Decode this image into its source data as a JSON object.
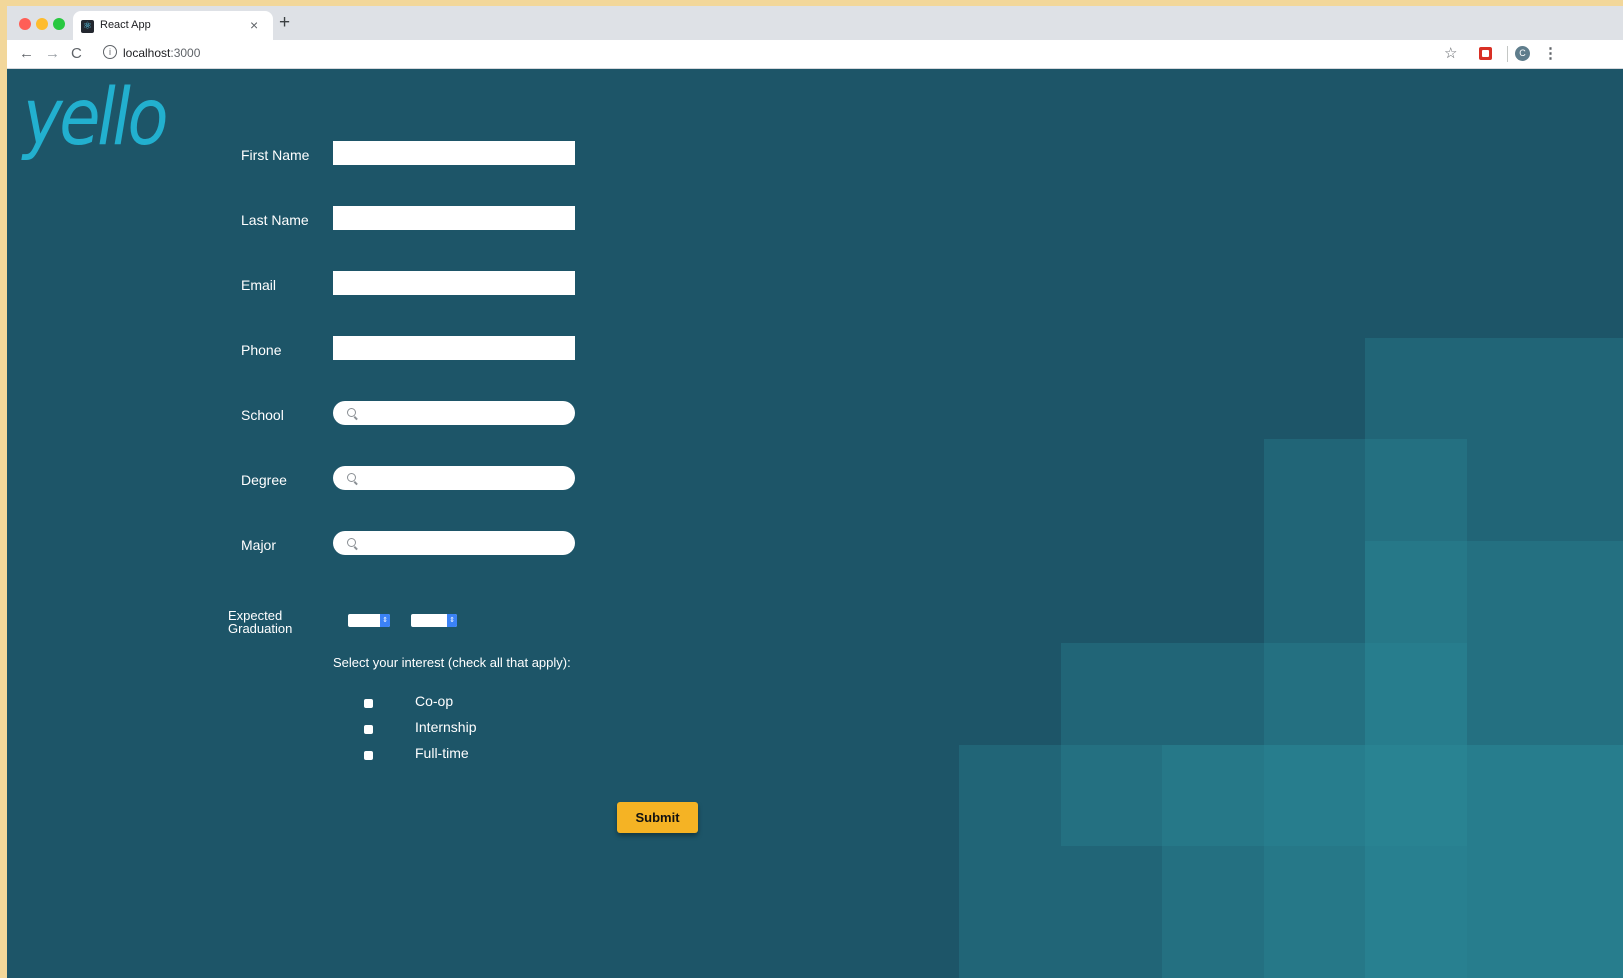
{
  "browser": {
    "tab_title": "React App",
    "tab_close": "×",
    "new_tab": "+",
    "url_host": "localhost",
    "url_port": ":3000",
    "nav_back": "←",
    "nav_forward": "→",
    "nav_reload": "C",
    "info_glyph": "i",
    "bookmark_star": "☆",
    "profile_initial": "C",
    "menu_glyph": "⋮"
  },
  "page": {
    "logo_text": "yello",
    "fields": [
      {
        "label": "First Name",
        "value": ""
      },
      {
        "label": "Last Name",
        "value": ""
      },
      {
        "label": "Email",
        "value": ""
      },
      {
        "label": "Phone",
        "value": ""
      }
    ],
    "search_fields": [
      {
        "label": "School",
        "value": ""
      },
      {
        "label": "Degree",
        "value": ""
      },
      {
        "label": "Major",
        "value": ""
      }
    ],
    "graduation": {
      "label_line1": "Expected",
      "label_line2": "Graduation",
      "month_value": "",
      "year_value": ""
    },
    "interest_prompt": "Select your interest (check all that apply):",
    "interests": [
      {
        "label": "Co-op",
        "checked": false
      },
      {
        "label": "Internship",
        "checked": false
      },
      {
        "label": "Full-time",
        "checked": false
      }
    ],
    "submit_label": "Submit"
  },
  "colors": {
    "background": "#1d5568",
    "logo": "#22b0cf",
    "submit": "#f5b324",
    "select_arrow": "#3b82f6"
  },
  "icons": [
    "react-favicon-icon",
    "search-icon",
    "star-icon",
    "extension-icon",
    "info-icon",
    "kebab-menu-icon"
  ]
}
